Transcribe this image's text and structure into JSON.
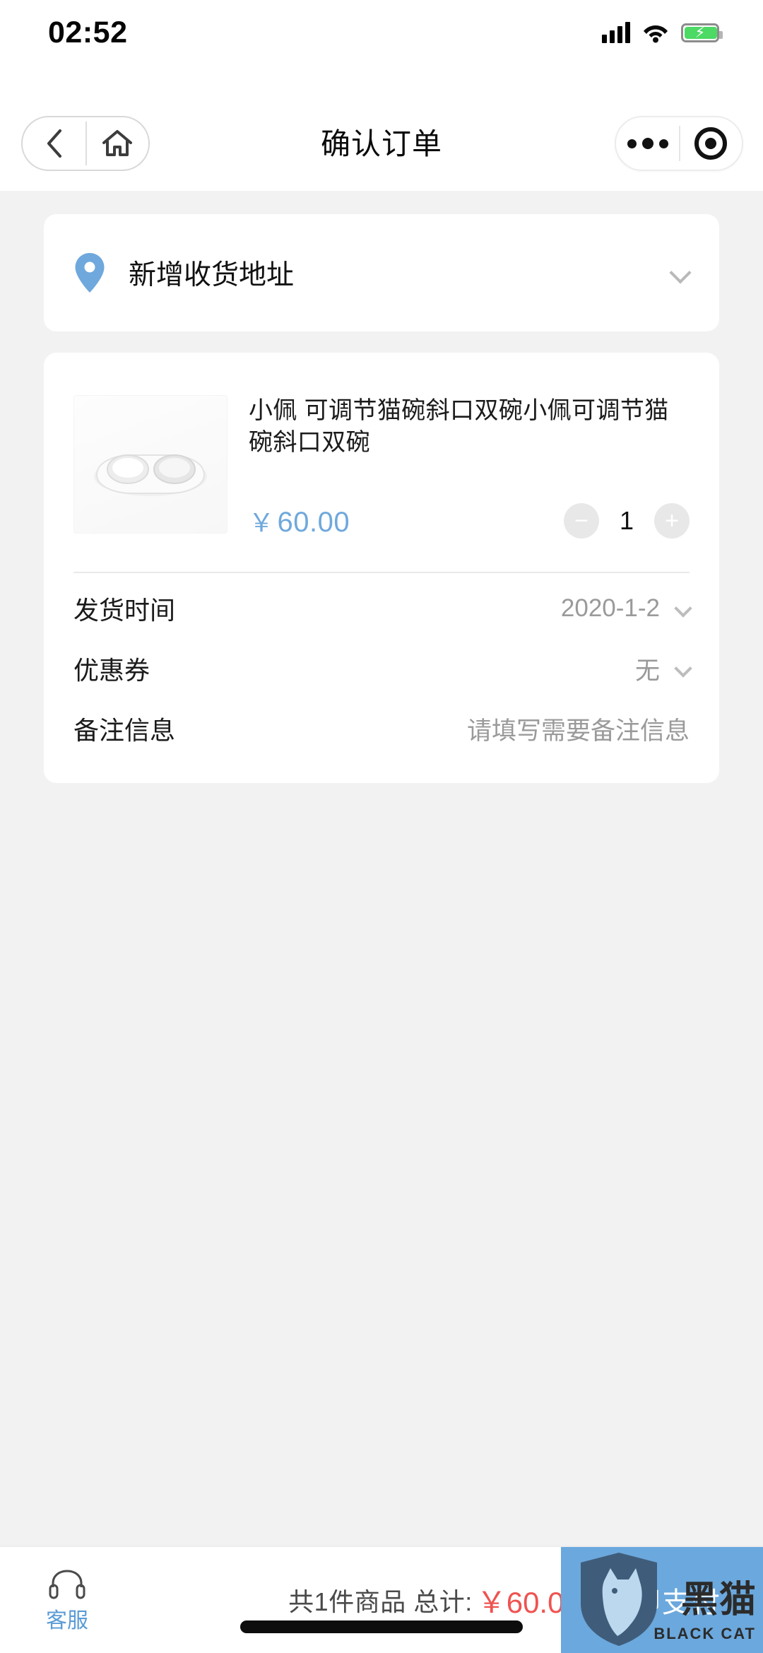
{
  "status_bar": {
    "time": "02:52",
    "signal_icon": "cellular-signal-icon",
    "wifi_icon": "wifi-icon",
    "battery_icon": "battery-charging-icon",
    "battery_bolt": "⚡"
  },
  "nav_bar": {
    "title": "确认订单",
    "back_icon": "chevron-left-icon",
    "home_icon": "home-icon",
    "more_icon": "more-dots-icon",
    "capsule_icon": "target-circle-icon"
  },
  "address": {
    "label": "新增收货地址",
    "pin_icon": "location-pin-icon",
    "pin_color": "#6fa8dc",
    "chevron_icon": "chevron-right-icon"
  },
  "product": {
    "title": "小佩 可调节猫碗斜口双碗小佩可调节猫碗斜口双碗",
    "thumb_alt": "cat-bowl-product-image",
    "currency": "￥",
    "price": "60.00",
    "price_color": "#6fa8dc",
    "decrease_label": "−",
    "increase_label": "+",
    "quantity": "1"
  },
  "details": [
    {
      "label": "发货时间",
      "value": "2020-1-2",
      "has_chevron": true
    },
    {
      "label": "优惠券",
      "value": "无",
      "has_chevron": true
    },
    {
      "label": "备注信息",
      "value": "请填写需要备注信息",
      "has_chevron": false
    }
  ],
  "bottom_bar": {
    "service_label": "客服",
    "service_icon": "headset-icon",
    "summary_text": "共1件商品 总计:",
    "total_currency": "￥",
    "total_amount": "60.00",
    "total_color": "#ef5350",
    "pay_label": "立即支付",
    "pay_color": "#6ba8dd"
  },
  "watermark": {
    "title": "黑猫",
    "subtitle": "BLACK CAT",
    "icon": "black-cat-shield-icon"
  }
}
